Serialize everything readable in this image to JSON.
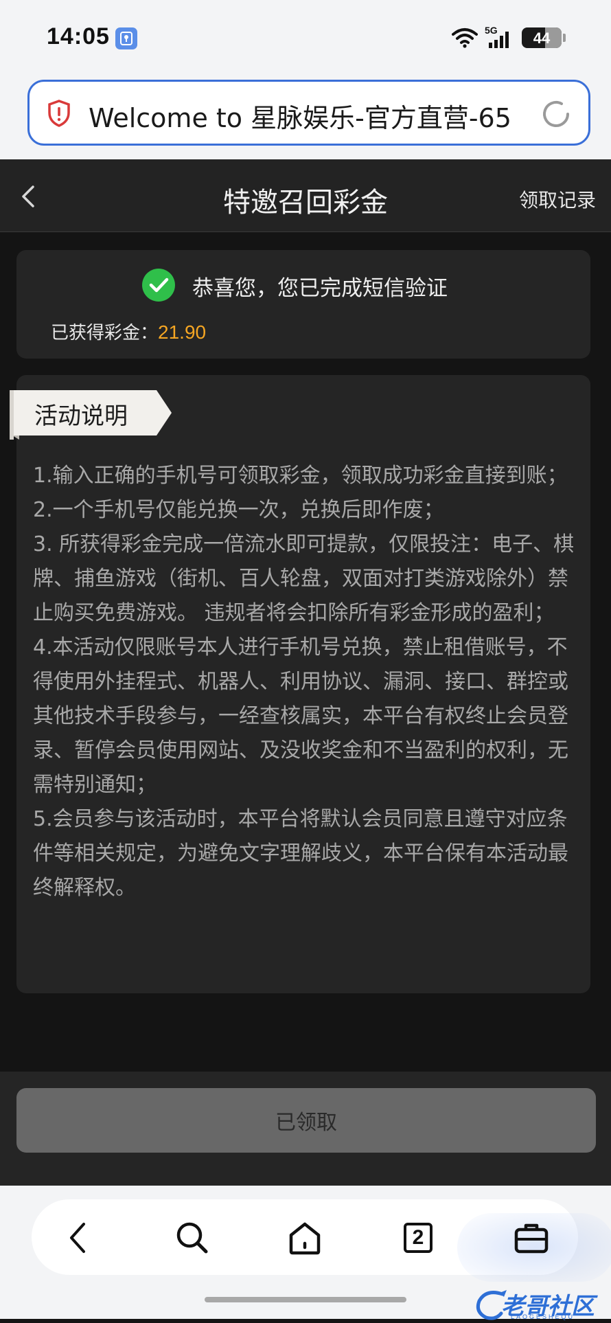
{
  "status_bar": {
    "time": "14:05",
    "network": "5G",
    "battery": "44",
    "battery_level_percent": 58
  },
  "browser": {
    "url_text": "Welcome to 星脉娱乐-官方直营-65",
    "tab_count": "2"
  },
  "header": {
    "title": "特邀召回彩金",
    "record_link": "领取记录"
  },
  "verify": {
    "message": "恭喜您，您已完成短信验证",
    "bonus_label": "已获得彩金：",
    "bonus_value": "21.90"
  },
  "rules": {
    "tag": "活动说明",
    "items": [
      "1.输入正确的手机号可领取彩金，领取成功彩金直接到账；",
      "2.一个手机号仅能兑换一次，兑换后即作废；",
      "3. 所获得彩金完成一倍流水即可提款，仅限投注：电子、棋牌、捕鱼游戏（街机、百人轮盘，双面对打类游戏除外）禁止购买免费游戏。 违规者将会扣除所有彩金形成的盈利；",
      "4.本活动仅限账号本人进行手机号兑换，禁止租借账号，不得使用外挂程式、机器人、利用协议、漏洞、接口、群控或其他技术手段参与，一经查核属实，本平台有权终止会员登录、暂停会员使用网站、及没收奖金和不当盈利的权利，无需特别通知；",
      "5.会员参与该活动时，本平台将默认会员同意且遵守对应条件等相关规定，为避免文字理解歧义，本平台保有本活动最终解释权。"
    ]
  },
  "footer": {
    "claimed_button": "已领取"
  },
  "watermark": {
    "text": "老哥社区",
    "sub": "LAOGESHEQU"
  },
  "colors": {
    "accent_bonus": "#f5a623",
    "success_green": "#2fbf4a",
    "url_border": "#3a6fd8"
  }
}
